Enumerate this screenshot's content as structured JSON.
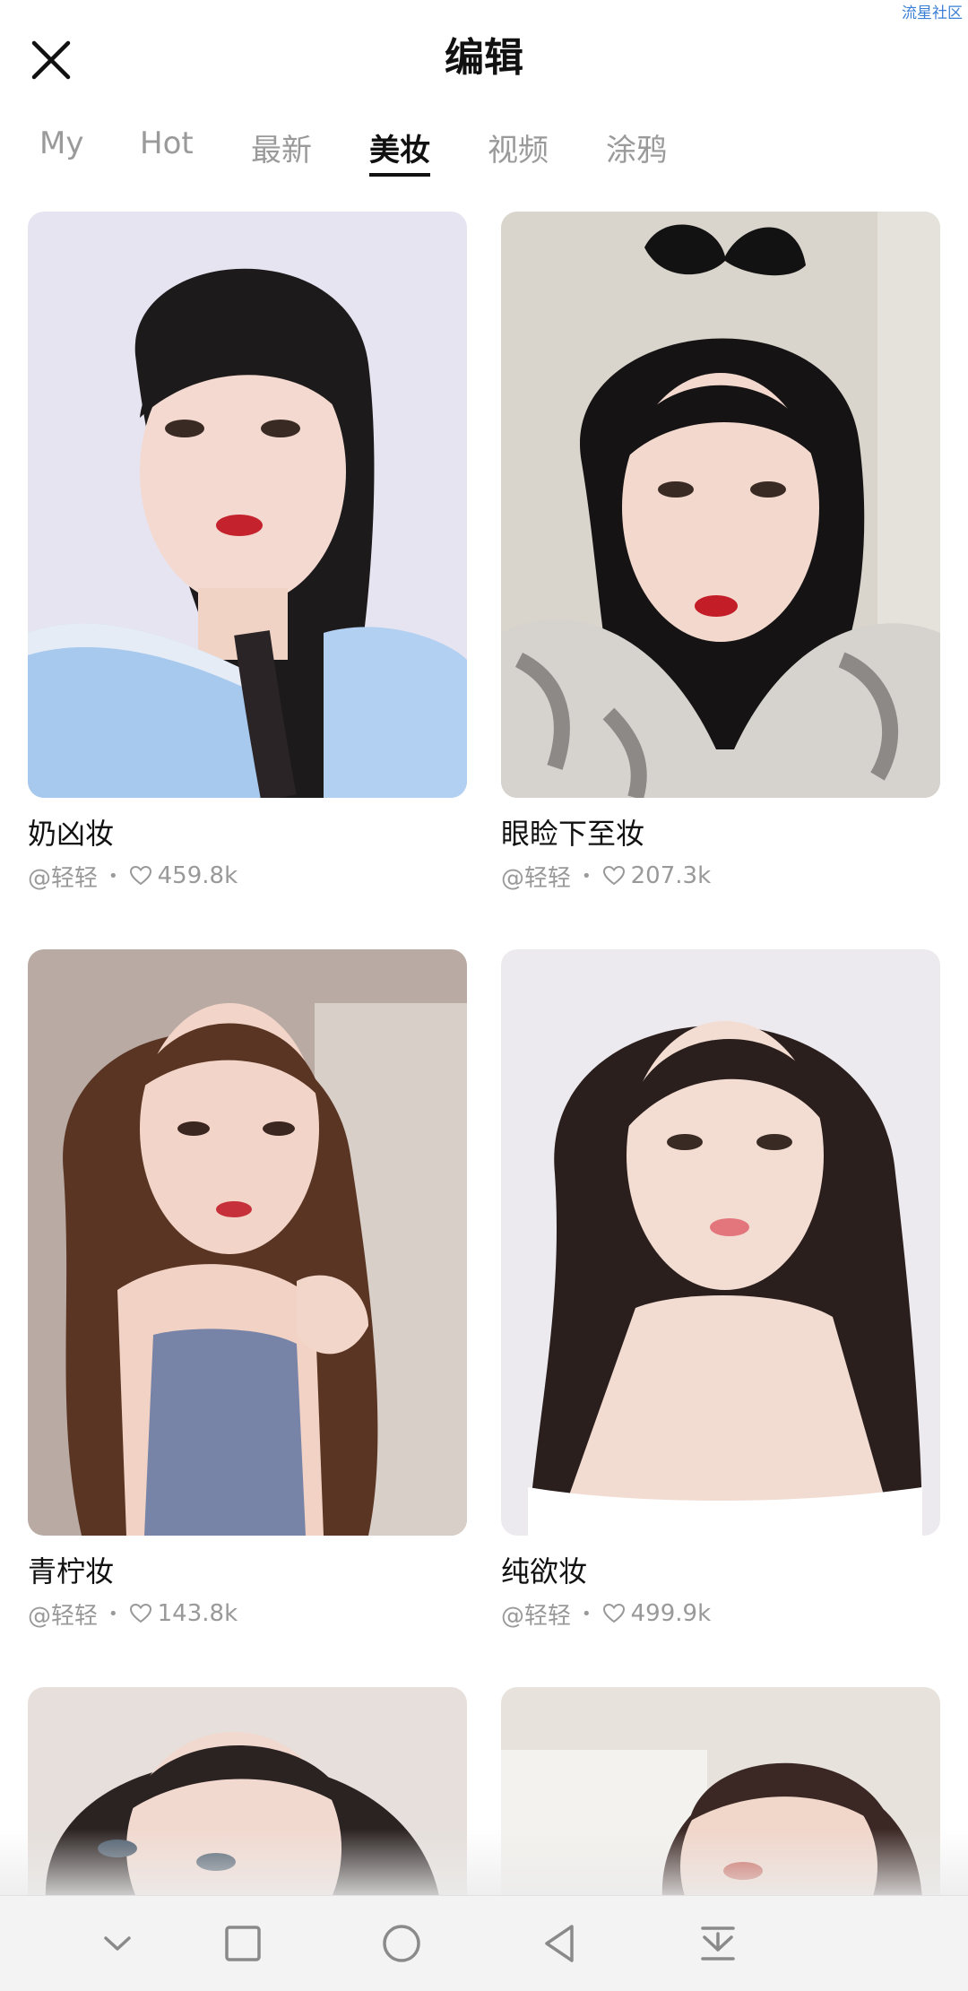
{
  "watermark": "流星社区",
  "header": {
    "title": "编辑"
  },
  "tabs": [
    {
      "label": "My",
      "active": false
    },
    {
      "label": "Hot",
      "active": false
    },
    {
      "label": "最新",
      "active": false
    },
    {
      "label": "美妆",
      "active": true
    },
    {
      "label": "视频",
      "active": false
    },
    {
      "label": "涂鸦",
      "active": false
    }
  ],
  "cards": [
    {
      "title": "奶凶妆",
      "author": "@轻轻",
      "likes": "459.8k"
    },
    {
      "title": "眼睑下至妆",
      "author": "@轻轻",
      "likes": "207.3k"
    },
    {
      "title": "青柠妆",
      "author": "@轻轻",
      "likes": "143.8k"
    },
    {
      "title": "纯欲妆",
      "author": "@轻轻",
      "likes": "499.9k"
    },
    {
      "title": "",
      "author": "",
      "likes": ""
    },
    {
      "title": "",
      "author": "",
      "likes": ""
    }
  ],
  "navbar": {
    "icons": [
      "chevron-down-icon",
      "square-icon",
      "circle-icon",
      "back-triangle-icon",
      "download-icon"
    ]
  },
  "colors": {
    "active_tab": "#111111",
    "inactive_tab": "#9a9a9a",
    "meta": "#999999"
  }
}
